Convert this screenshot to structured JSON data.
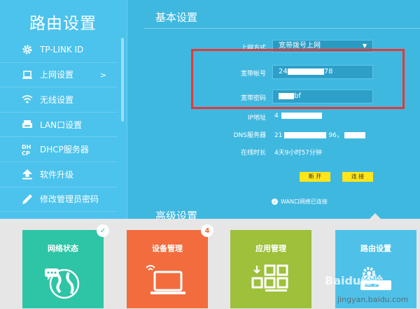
{
  "sidebar": {
    "title": "路由设置",
    "items": [
      {
        "label": "TP-LINK ID",
        "icon": "gear-icon"
      },
      {
        "label": "上网设置",
        "icon": "laptop-icon",
        "arrow": ">"
      },
      {
        "label": "无线设置",
        "icon": "wifi-icon"
      },
      {
        "label": "LAN口设置",
        "icon": "router-icon"
      },
      {
        "label": "DHCP服务器",
        "icon": "dhcp-icon"
      },
      {
        "label": "软件升级",
        "icon": "upload-icon"
      },
      {
        "label": "修改管理员密码",
        "icon": "pencil-icon"
      }
    ]
  },
  "basic": {
    "title": "基本设置",
    "mode_label": "上网方式",
    "mode_value": "宽带拨号上网",
    "account_label": "宽带帐号",
    "account_prefix": "24",
    "account_suffix": "78",
    "password_label": "宽带密码",
    "password_suffix": "bf",
    "ip_label": "IP地址",
    "ip_prefix": "4",
    "dns_label": "DNS服务器",
    "dns_prefix": "21",
    "dns_mid": "96，",
    "uptime_label": "在线时长",
    "uptime_value": "4天9小时57分钟",
    "disconnect_label": "断 开",
    "connect_label": "连 接",
    "wan_status": "WAN口网络已连接"
  },
  "advanced": {
    "title": "高级设置",
    "tiles": [
      {
        "label": "网络状态",
        "color": "#2ec4a6",
        "badge": "✓",
        "icon": "globe-icon"
      },
      {
        "label": "设备管理",
        "color": "#f26c3e",
        "badge": "4",
        "icon": "laptop-icon"
      },
      {
        "label": "应用管理",
        "color": "#9ec03a",
        "badge": "",
        "icon": "apps-icon"
      },
      {
        "label": "路由设置",
        "color": "#4fc1e9",
        "badge": "",
        "icon": "router-gear-icon"
      }
    ]
  },
  "watermark": {
    "text": "Baidu经验",
    "url": "jingyan.baidu.com"
  }
}
